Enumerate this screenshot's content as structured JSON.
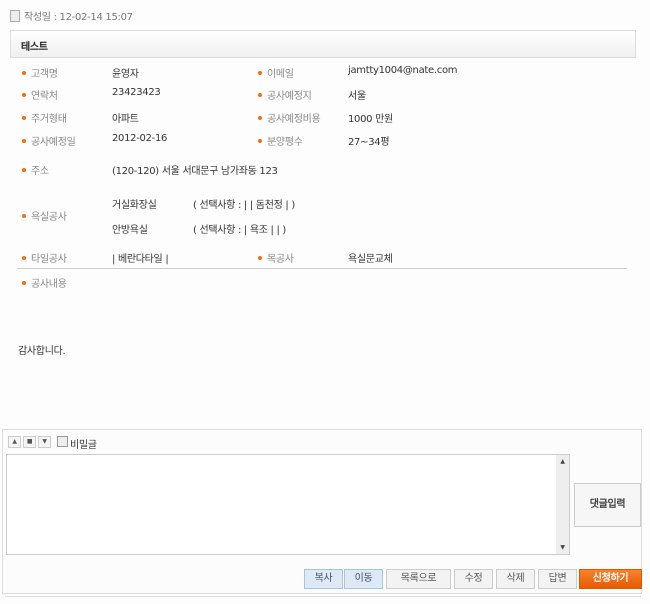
{
  "date": {
    "label": "작성일 : 12-02-14 15:07"
  },
  "title": "테스트",
  "fields": [
    {
      "label": "고객명",
      "value": "윤영자"
    },
    {
      "label": "이메일",
      "value": "jamtty1004@nate.com"
    },
    {
      "label": "연락처",
      "value": "23423423"
    },
    {
      "label": "공사예정지",
      "value": "서울"
    },
    {
      "label": "주거형태",
      "value": "아파트"
    },
    {
      "label": "공사예정비용",
      "value": "1000 만원"
    },
    {
      "label": "공사예정일",
      "value": "2012-02-16"
    },
    {
      "label": "분양평수",
      "value": "27~34평"
    },
    {
      "label": "주소",
      "value": "(120-120) 서울 서대문구 남가좌동 123"
    },
    {
      "label": "욕실공사",
      "value": ""
    },
    {
      "label": "타일공사",
      "value": "| 베란다타일 |"
    },
    {
      "label": "목공사",
      "value": "욕실문교체"
    },
    {
      "label": "공사내용",
      "value": ""
    }
  ],
  "bath": [
    {
      "name": "거실화장실",
      "option": "( 선택사항 : | | 돔천정 | )"
    },
    {
      "name": "안방욕실",
      "option": "( 선택사항 : | 욕조 | | )"
    }
  ],
  "content": "감사합니다.",
  "comment": {
    "secret_label": "비밀글",
    "submit": "댓글입력"
  },
  "buttons": {
    "copy": "복사",
    "move": "이동",
    "list": "목록으로",
    "edit": "수정",
    "delete": "삭제",
    "reply": "답변",
    "apply": "신청하기"
  }
}
